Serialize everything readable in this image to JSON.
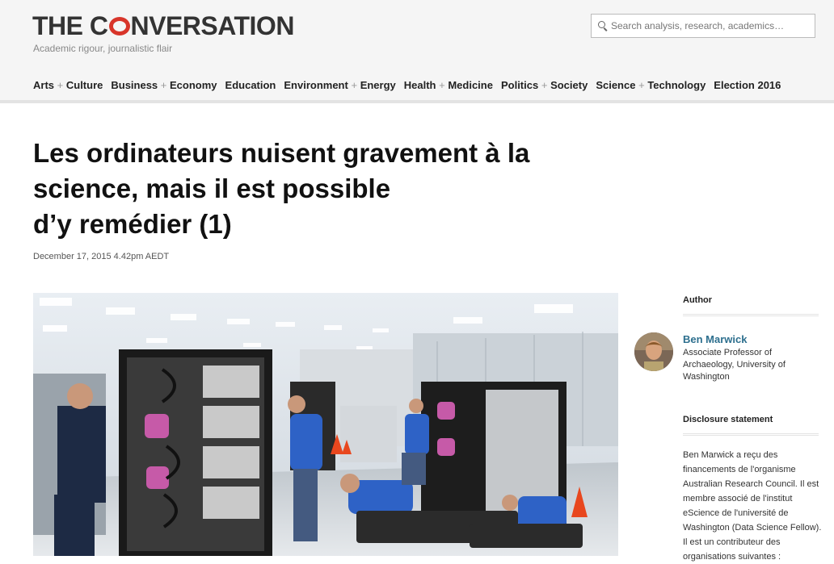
{
  "header": {
    "logo": {
      "part1": "THE C",
      "part2": "NVERSATION"
    },
    "tagline": "Academic rigour, journalistic flair",
    "search": {
      "placeholder": "Search analysis, research, academics…"
    }
  },
  "nav": {
    "items": [
      {
        "a": "Arts",
        "b": "Culture"
      },
      {
        "a": "Business",
        "b": "Economy"
      },
      {
        "a": "Education"
      },
      {
        "a": "Environment",
        "b": "Energy"
      },
      {
        "a": "Health",
        "b": "Medicine"
      },
      {
        "a": "Politics",
        "b": "Society"
      },
      {
        "a": "Science",
        "b": "Technology"
      },
      {
        "a": "Election 2016"
      }
    ],
    "separator": "+"
  },
  "article": {
    "title_line1": "Les ordinateurs nuisent gravement à la",
    "title_line2": "science, mais il est possible",
    "title_line3": "d’y remédier (1)",
    "date": "December 17, 2015 4.42pm AEDT"
  },
  "sidebar": {
    "author_heading": "Author",
    "author": {
      "name": "Ben Marwick",
      "role": "Associate Professor of Archaeology, University of Washington"
    },
    "disclosure_heading": "Disclosure statement",
    "disclosure_text": "Ben Marwick a reçu des financements de l'organisme Australian Research Council. Il est membre associé de l'institut eScience de l'université de Washington (Data Science Fellow). Il est un contributeur des organisations suivantes :"
  },
  "colors": {
    "brand_red": "#d8352a",
    "author_link": "#2d6f8e",
    "header_bg": "#f5f5f5"
  }
}
